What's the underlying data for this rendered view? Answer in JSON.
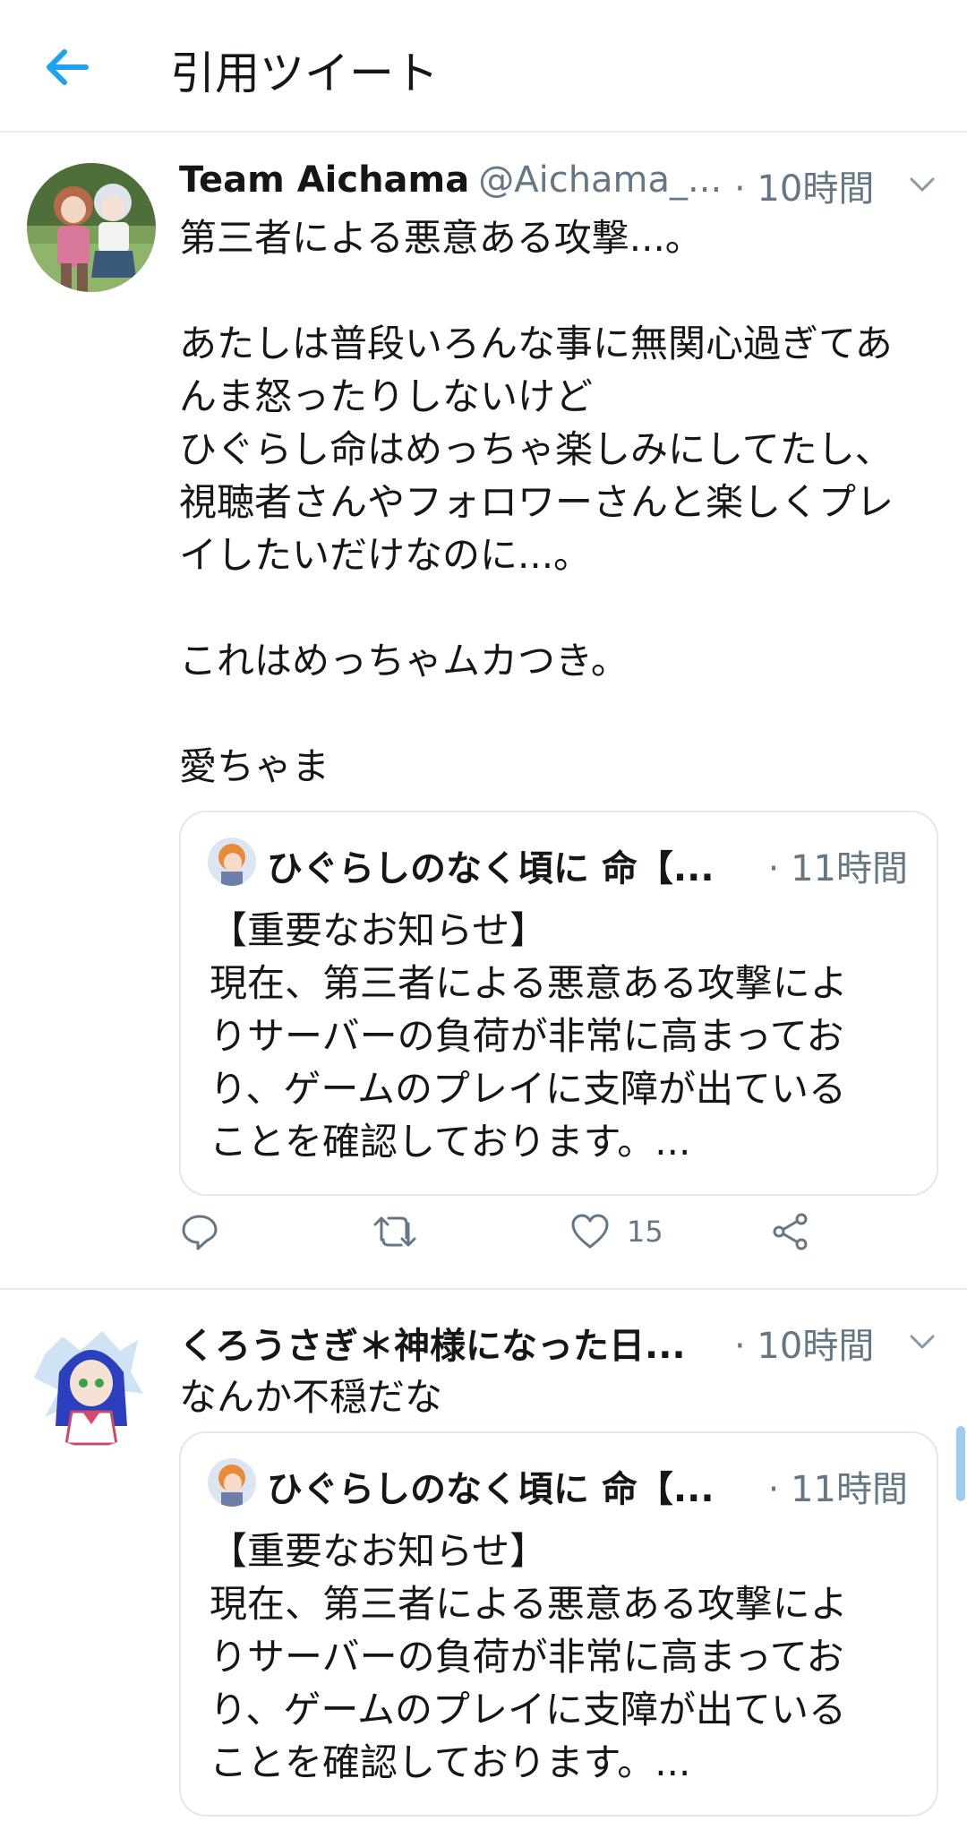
{
  "header": {
    "title": "引用ツイート",
    "back_icon": "arrow-left-icon"
  },
  "tweets": [
    {
      "name": "Team Aichama",
      "handle": "@Aichama_...",
      "time": "· 10時間",
      "body": [
        "第三者による悪意ある攻撃...。",
        "",
        "あたしは普段いろんな事に無関心過ぎてあ",
        "んま怒ったりしないけど",
        "ひぐらし命はめっちゃ楽しみにしてたし、",
        "視聴者さんやフォロワーさんと楽しくプレ",
        "イしたいだけなのに...。",
        "",
        "これはめっちゃムカつき。",
        "",
        "愛ちゃま"
      ],
      "quote": {
        "name": "ひぐらしのなく頃に 命【...",
        "time": "· 11時間",
        "body": [
          "【重要なお知らせ】",
          "現在、第三者による悪意ある攻撃によ",
          "りサーバーの負荷が非常に高まってお",
          "り、ゲームのプレイに支障が出ている",
          "ことを確認しております。..."
        ]
      },
      "actions": {
        "like_count": "15"
      }
    },
    {
      "name": "くろうさぎ＊神様になった日...",
      "time": "· 10時間",
      "body": [
        "なんか不穏だな"
      ],
      "quote": {
        "name": "ひぐらしのなく頃に 命【...",
        "time": "· 11時間",
        "body": [
          "【重要なお知らせ】",
          "現在、第三者による悪意ある攻撃によ",
          "りサーバーの負荷が非常に高まってお",
          "り、ゲームのプレイに支障が出ている",
          "ことを確認しております。..."
        ]
      }
    }
  ],
  "colors": {
    "accent": "#1da1f2",
    "secondary_text": "#657786",
    "border": "#e1e8ed"
  }
}
